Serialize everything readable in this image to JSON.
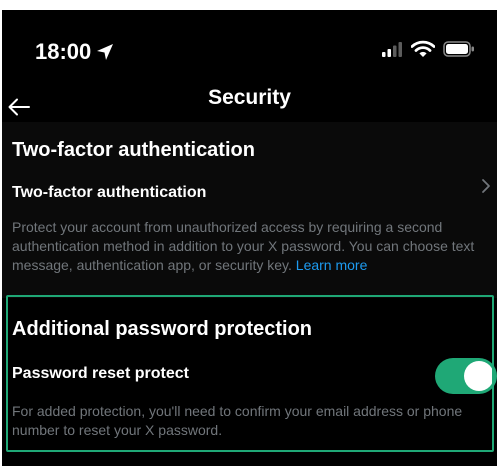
{
  "status_bar": {
    "time": "18:00",
    "icons": [
      "location-arrow-icon",
      "signal-icon",
      "wifi-icon",
      "battery-icon"
    ]
  },
  "header": {
    "back_icon": "back-arrow-icon",
    "title": "Security"
  },
  "two_factor": {
    "section_title": "Two-factor authentication",
    "row_label": "Two-factor authentication",
    "row_icon": "chevron-right-icon",
    "description": "Protect your account from unauthorized access by requiring a second authentication method in addition to your X password. You can choose text message, authentication app, or security key.",
    "learn_more": "Learn more"
  },
  "password_protection": {
    "section_title": "Additional password protection",
    "row_label": "Password reset protect",
    "toggle_on": true,
    "description": "For added protection, you'll need to confirm your email address or phone number to reset your X password."
  },
  "colors": {
    "background": "#000000",
    "text_primary": "#ffffff",
    "text_secondary": "#71767b",
    "link": "#1d9bf0",
    "toggle_on": "#1fa876",
    "highlight_border": "#1fa876"
  }
}
